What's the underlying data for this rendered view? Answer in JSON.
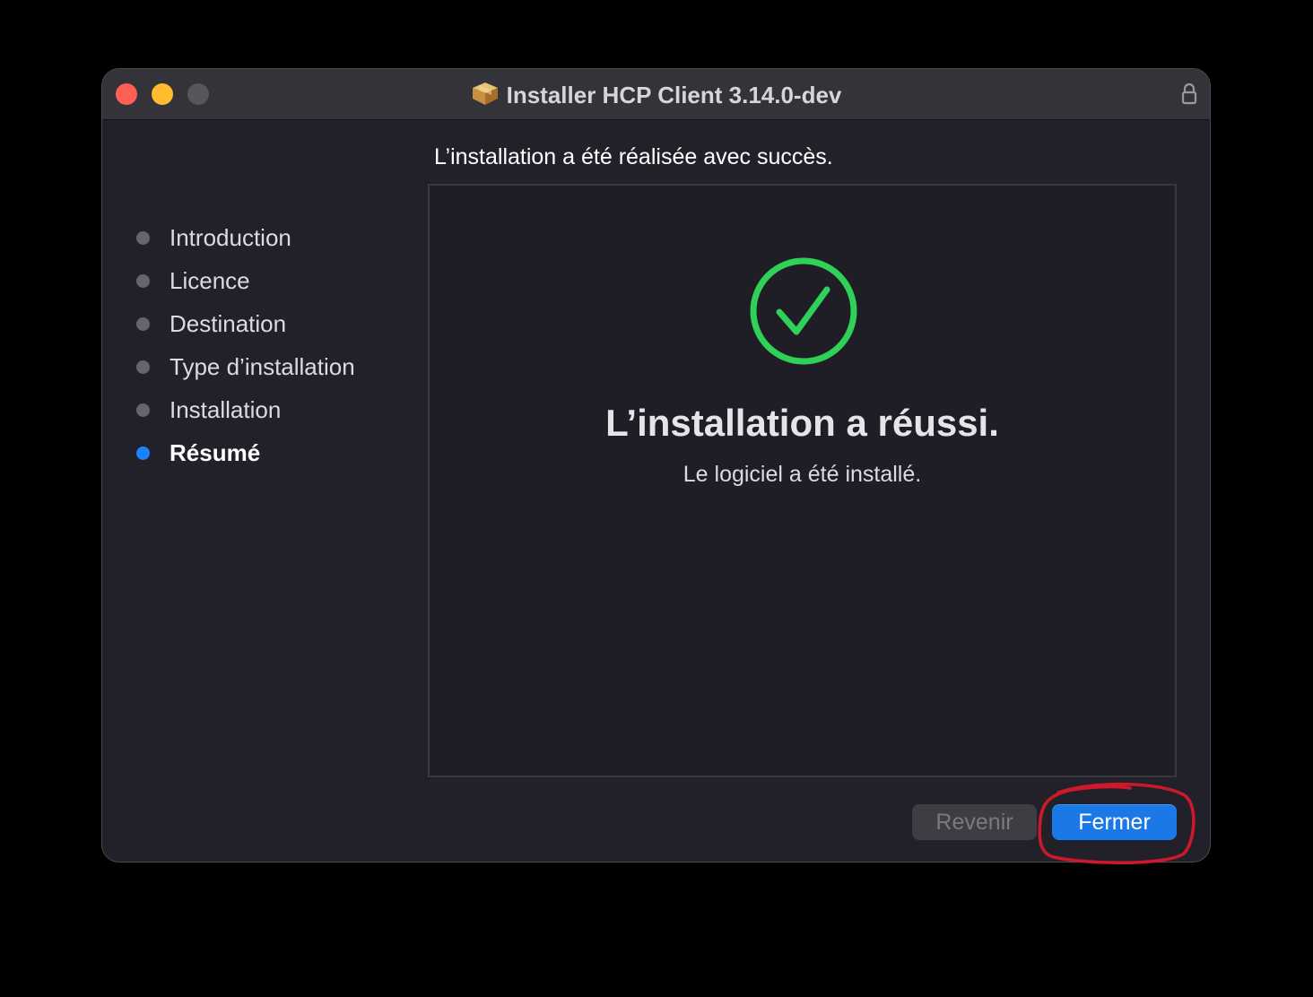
{
  "window": {
    "title": "Installer HCP Client 3.14.0-dev",
    "icon": "package-icon",
    "lock_icon": "lock-icon"
  },
  "sidebar": {
    "steps": [
      {
        "label": "Introduction",
        "active": false
      },
      {
        "label": "Licence",
        "active": false
      },
      {
        "label": "Destination",
        "active": false
      },
      {
        "label": "Type d’installation",
        "active": false
      },
      {
        "label": "Installation",
        "active": false
      },
      {
        "label": "Résumé",
        "active": true
      }
    ]
  },
  "main": {
    "heading": "L’installation a été réalisée avec succès.",
    "success_icon": "checkmark-circle-icon",
    "title": "L’installation a réussi.",
    "subtitle": "Le logiciel a été installé."
  },
  "buttons": {
    "back_label": "Revenir",
    "close_label": "Fermer"
  },
  "colors": {
    "accent": "#1a79e6",
    "success": "#30d158",
    "active_step": "#1a84ff",
    "annotation": "#d0182c"
  }
}
